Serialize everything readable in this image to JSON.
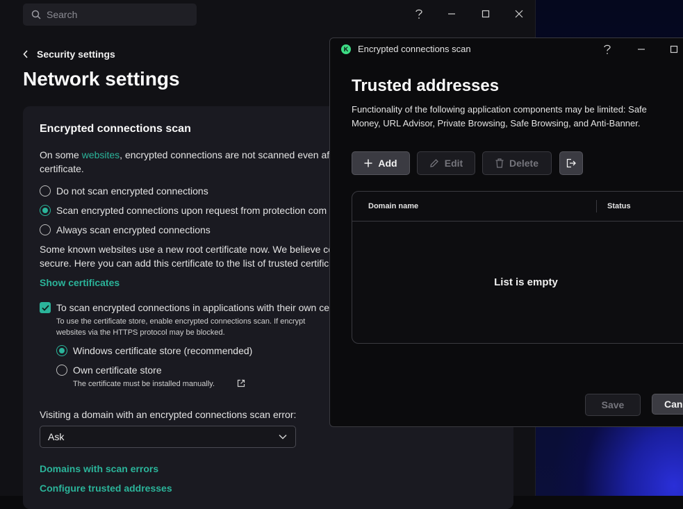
{
  "main": {
    "search_placeholder": "Search",
    "back_label": "Security settings",
    "page_title": "Network settings",
    "card": {
      "title": "Encrypted connections scan",
      "intro_before": "On some ",
      "intro_link": "websites",
      "intro_after": ", encrypted connections are not scanned even aft",
      "intro_line2": "certificate.",
      "radio_options": [
        {
          "label": "Do not scan encrypted connections",
          "selected": false
        },
        {
          "label": "Scan encrypted connections upon request from protection com",
          "selected": true
        },
        {
          "label": "Always scan encrypted connections",
          "selected": false
        }
      ],
      "root_note_line1": "Some known websites use a new root certificate now. We believe co",
      "root_note_line2": "secure. Here you can add this certificate to the list of trusted certific",
      "show_certificates": "Show certificates",
      "apps_checkbox_label": "To scan encrypted connections in applications with their own ce",
      "apps_note_line1": "To use the certificate store, enable encrypted connections scan. If encrypt",
      "apps_note_line2": "websites via the HTTPS protocol may be blocked.",
      "store_options": [
        {
          "label": "Windows certificate store (recommended)",
          "selected": true
        },
        {
          "label": "Own certificate store",
          "selected": false
        }
      ],
      "own_store_note": "The certificate must be installed manually.",
      "error_label": "Visiting a domain with an encrypted connections scan error:",
      "error_select_value": "Ask",
      "domains_link": "Domains with scan errors",
      "trusted_link": "Configure trusted addresses"
    }
  },
  "dialog": {
    "window_title": "Encrypted connections scan",
    "logo_letter": "K",
    "title": "Trusted addresses",
    "description": "Functionality of the following application components may be limited: Safe Money, URL Advisor, Private Browsing, Safe Browsing, and Anti-Banner.",
    "buttons": {
      "add": "Add",
      "edit": "Edit",
      "delete": "Delete"
    },
    "table": {
      "columns": [
        "Domain name",
        "Status"
      ],
      "empty_text": "List is empty"
    },
    "footer": {
      "save": "Save",
      "cancel": "Canc"
    }
  },
  "colors": {
    "accent": "#2bb49a",
    "logo": "#3ddc84"
  }
}
